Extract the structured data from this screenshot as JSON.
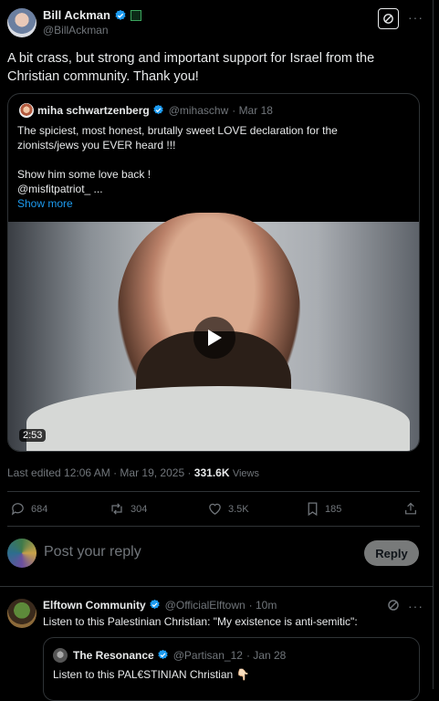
{
  "main_post": {
    "author_name": "Bill Ackman",
    "author_handle": "@BillAckman",
    "text_line1": "A bit crass, but strong and important support for Israel from the",
    "text_line2": "Christian community. Thank you!"
  },
  "quoted_post": {
    "author_name": "miha schwartzenberg",
    "author_handle": "@mihaschw",
    "date": "· Mar 18",
    "line1": "The spiciest, most honest, brutally sweet LOVE declaration for the",
    "line2": "zionists/jews you EVER heard !!!",
    "line3": "Show him some love back !",
    "line4": "@misfitpatriot_  ...",
    "show_more": "Show more",
    "video_duration": "2:53"
  },
  "meta": {
    "edited": "Last edited 12:06 AM · Mar 19, 2025 ·",
    "views_count": "331.6K",
    "views_label": "Views"
  },
  "actions": {
    "replies": "684",
    "reposts": "304",
    "likes": "3.5K",
    "bookmarks": "185"
  },
  "reply_box": {
    "placeholder": "Post your reply",
    "button": "Reply"
  },
  "reply_post": {
    "author_name": "Elftown Community",
    "author_handle": "@OfficialElftown",
    "time": "· 10m",
    "text": "Listen to this Palestinian Christian: \"My existence is anti-semitic\":",
    "quoted_name": "The Resonance",
    "quoted_handle": "@Partisan_12",
    "quoted_date": "· Jan 28",
    "quoted_text": "Listen to this PAL€STINIAN Christian 👇🏻"
  },
  "colors": {
    "accent": "#1d9bf0",
    "background": "#000000",
    "muted": "#71767b"
  }
}
